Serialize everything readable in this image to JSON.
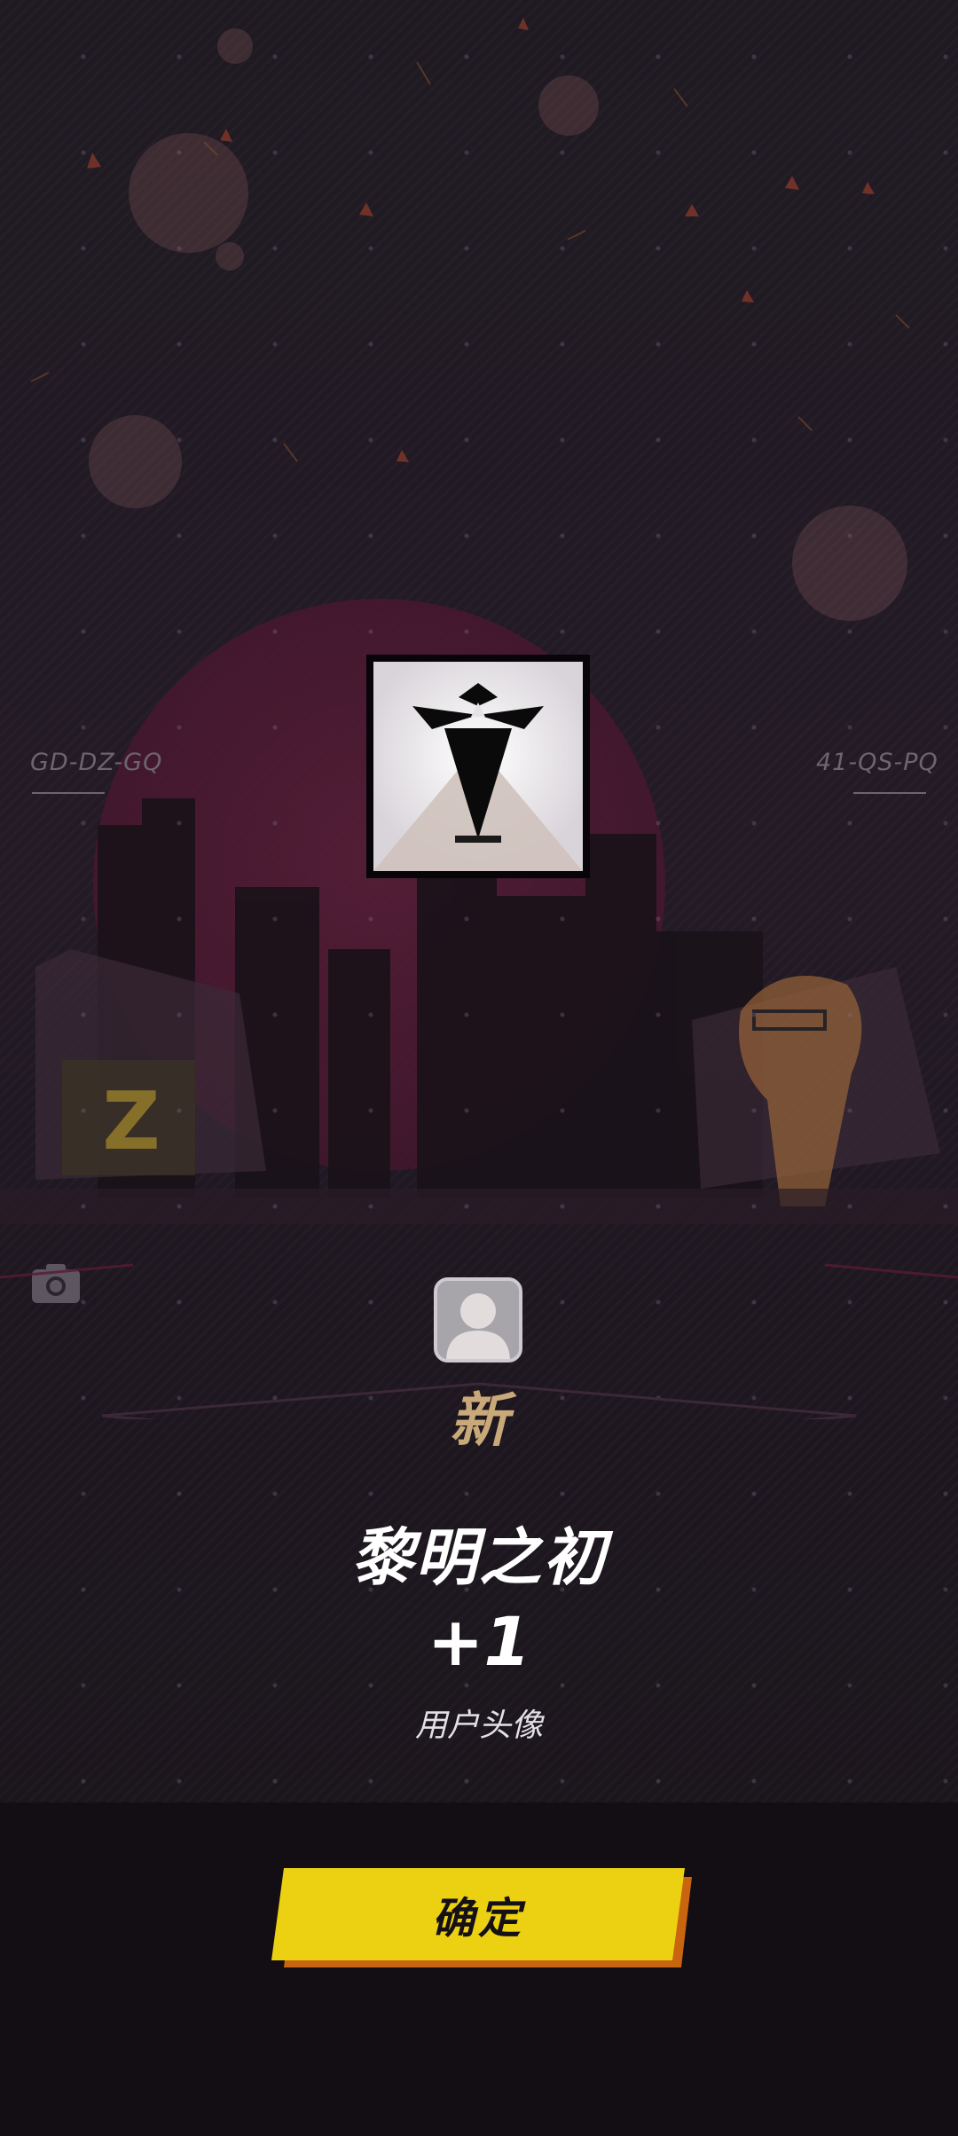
{
  "scene": {
    "left_code": "GD-DZ-GQ",
    "right_code": "41-QS-PQ"
  },
  "reward": {
    "new_label": "新",
    "name": "黎明之初",
    "quantity": "+1",
    "type": "用户头像"
  },
  "actions": {
    "confirm_label": "确定",
    "camera_icon": "camera-icon"
  },
  "colors": {
    "confirm_button": "#ecd112",
    "confirm_shadow": "#c8650e",
    "new_label": "#c9a97a",
    "sun": "#4a1830"
  }
}
